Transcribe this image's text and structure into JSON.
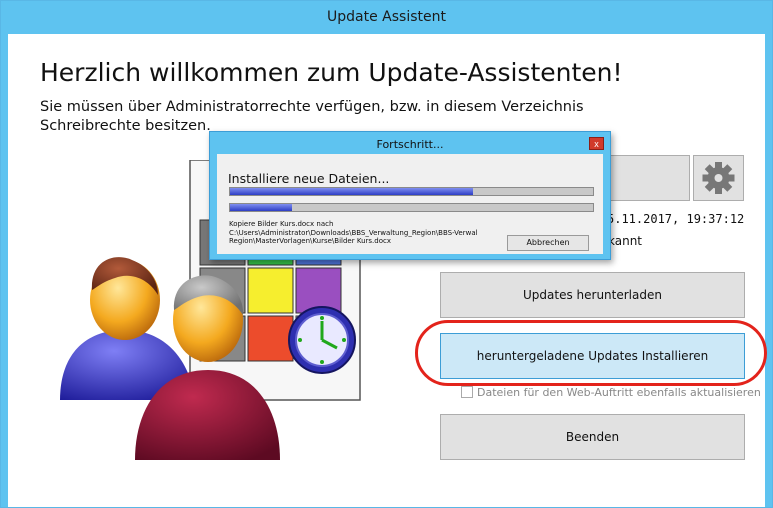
{
  "window": {
    "title": "Update Assistent"
  },
  "main": {
    "heading": "Herzlich willkommen zum Update-Assistenten!",
    "intro": "Sie müssen über Administratorrechte verfügen, bzw. in diesem Verzeichnis Schreibrechte besitzen.",
    "info_datetime": "5.11.2017, 19:37:12",
    "info_status": "kannt",
    "buttons": {
      "download": "Updates herunterladen",
      "install": "heruntergeladene Updates Installieren",
      "exit": "Beenden"
    },
    "checkbox_label": "Dateien für den Web-Auftritt ebenfalls aktualisieren",
    "checkbox_checked": false
  },
  "progress_dialog": {
    "title": "Fortschritt...",
    "close_label": "x",
    "status": "Installiere neue Dateien...",
    "overall_progress": 0.67,
    "file_progress": 0.17,
    "detail": "Kopiere Bilder Kurs.docx nach C:\\Users\\Administrator\\Downloads\\BBS_Verwaltung_Region\\BBS-Verwal Region\\MasterVorlagen\\Kurse\\Bilder Kurs.docx",
    "cancel_label": "Abbrechen"
  },
  "colors": {
    "titlebar": "#5ec3f0",
    "highlight_button": "#cce8f7",
    "annotation_circle": "#e3231b",
    "progress_fill": "#2c3dc4"
  },
  "icons": [
    "gear-icon",
    "clock-icon",
    "users-icon",
    "calendar-icon"
  ]
}
